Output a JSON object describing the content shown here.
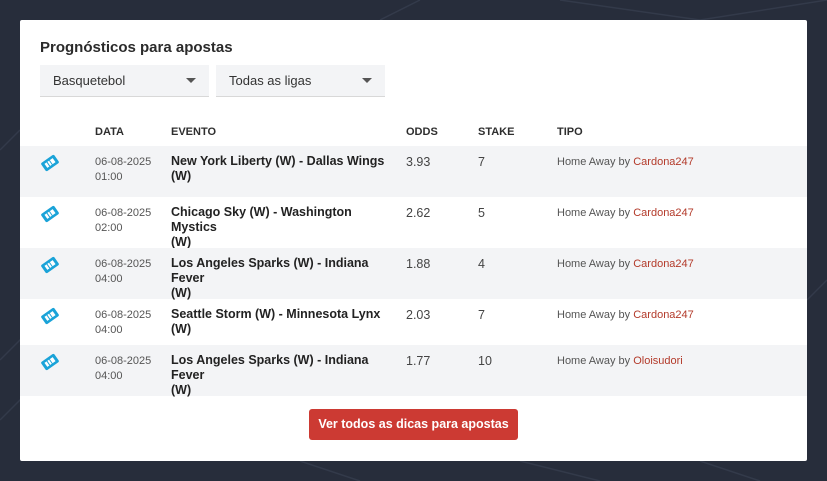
{
  "widget": {
    "title": "Prognósticos para apostas",
    "sport_select": {
      "selected": "Basquetebol"
    },
    "league_select": {
      "selected": "Todas as ligas"
    },
    "columns": {
      "date": "DATA",
      "event": "EVENTO",
      "odds": "ODDS",
      "stake": "STAKE",
      "tipo": "TIPO"
    },
    "rows": [
      {
        "date": "06-08-2025",
        "time": "01:00",
        "event_line1": "New York Liberty (W) - Dallas Wings",
        "event_line2": "(W)",
        "odds": "3.93",
        "stake": "7",
        "tipo_type": "Home Away",
        "tipo_by": " by ",
        "author": "Cardona247"
      },
      {
        "date": "06-08-2025",
        "time": "02:00",
        "event_line1": "Chicago Sky (W) - Washington Mystics",
        "event_line2": "(W)",
        "odds": "2.62",
        "stake": "5",
        "tipo_type": "Home Away",
        "tipo_by": " by ",
        "author": "Cardona247"
      },
      {
        "date": "06-08-2025",
        "time": "04:00",
        "event_line1": "Los Angeles Sparks (W) - Indiana Fever",
        "event_line2": "(W)",
        "odds": "1.88",
        "stake": "4",
        "tipo_type": "Home Away",
        "tipo_by": " by ",
        "author": "Cardona247"
      },
      {
        "date": "06-08-2025",
        "time": "04:00",
        "event_line1": "Seattle Storm (W) - Minnesota Lynx (W)",
        "event_line2": "",
        "odds": "2.03",
        "stake": "7",
        "tipo_type": "Home Away",
        "tipo_by": " by ",
        "author": "Cardona247"
      },
      {
        "date": "06-08-2025",
        "time": "04:00",
        "event_line1": "Los Angeles Sparks (W) - Indiana Fever",
        "event_line2": "(W)",
        "odds": "1.77",
        "stake": "10",
        "tipo_type": "Home Away",
        "tipo_by": " by ",
        "author": "Oloisudori"
      }
    ],
    "cta_label": "Ver todos as dicas para apostas"
  },
  "colors": {
    "accent": "#cc3a33",
    "ticket_icon": "#1aa3d8",
    "author_link": "#b33a2a",
    "background": "#272d3b"
  },
  "icons": {
    "row_icon": "ticket-icon",
    "select_caret": "caret-down-icon"
  }
}
